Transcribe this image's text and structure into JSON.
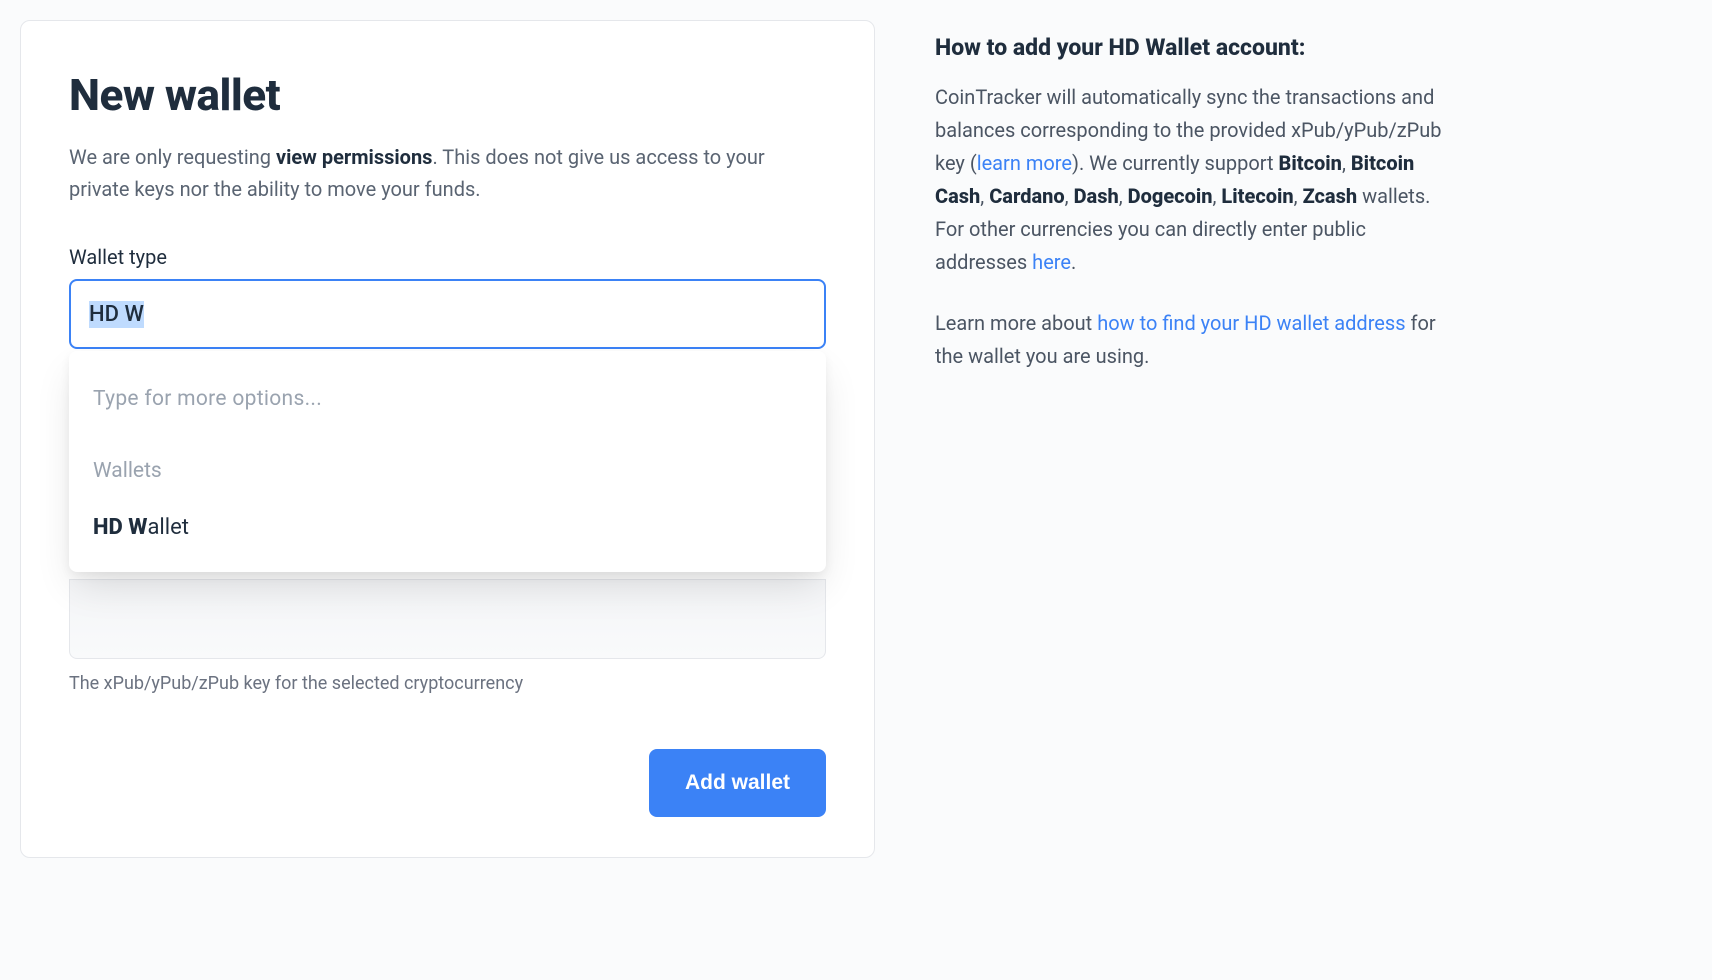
{
  "card": {
    "title": "New wallet",
    "subtitle_pre": "We are only requesting ",
    "subtitle_strong": "view permissions",
    "subtitle_post": ". This does not give us access to your private keys nor the ability to move your funds."
  },
  "wallet_type": {
    "label": "Wallet type",
    "input_value": "HD W",
    "dropdown_hint": "Type for more options...",
    "group_label": "Wallets",
    "option_match": "HD W",
    "option_rest": "allet"
  },
  "pubkey": {
    "helper": "The xPub/yPub/zPub key for the selected cryptocurrency"
  },
  "actions": {
    "add_wallet": "Add wallet"
  },
  "sidebar": {
    "title": "How to add your HD Wallet account:",
    "p1_a": "CoinTracker will automatically sync the transactions and balances corresponding to the provided xPub/yPub/zPub key (",
    "p1_learn_more": "learn more",
    "p1_b": "). We currently support ",
    "coins": {
      "bitcoin": "Bitcoin",
      "bitcoin_cash": "Bitcoin Cash",
      "cardano": "Cardano",
      "dash": "Dash",
      "dogecoin": "Dogecoin",
      "litecoin": "Litecoin",
      "zcash": "Zcash"
    },
    "p1_c": " wallets. For other currencies you can directly enter public addresses ",
    "p1_here": "here",
    "p1_d": ".",
    "p2_a": "Learn more about ",
    "p2_link": "how to find your HD wallet address",
    "p2_b": " for the wallet you are using."
  }
}
